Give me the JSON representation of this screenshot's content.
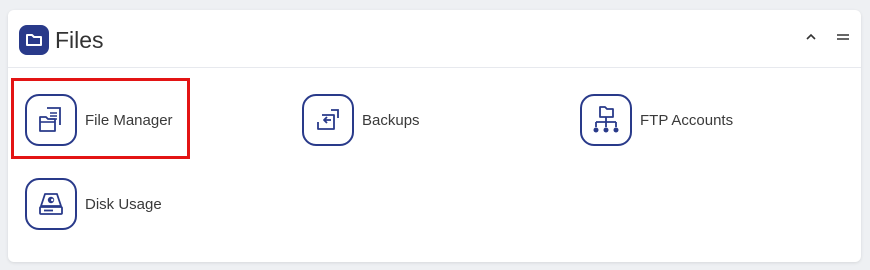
{
  "panel": {
    "title": "Files",
    "header_icon": "folder-icon",
    "collapse_icon": "chevron-up-icon",
    "menu_icon": "hamburger-icon"
  },
  "items": [
    {
      "label": "File Manager",
      "icon": "file-manager-icon"
    },
    {
      "label": "Backups",
      "icon": "backup-icon"
    },
    {
      "label": "FTP Accounts",
      "icon": "ftp-network-icon"
    },
    {
      "label": "Disk Usage",
      "icon": "disk-drive-icon"
    }
  ],
  "colors": {
    "accent": "#293a8a",
    "highlight": "#e31414"
  }
}
